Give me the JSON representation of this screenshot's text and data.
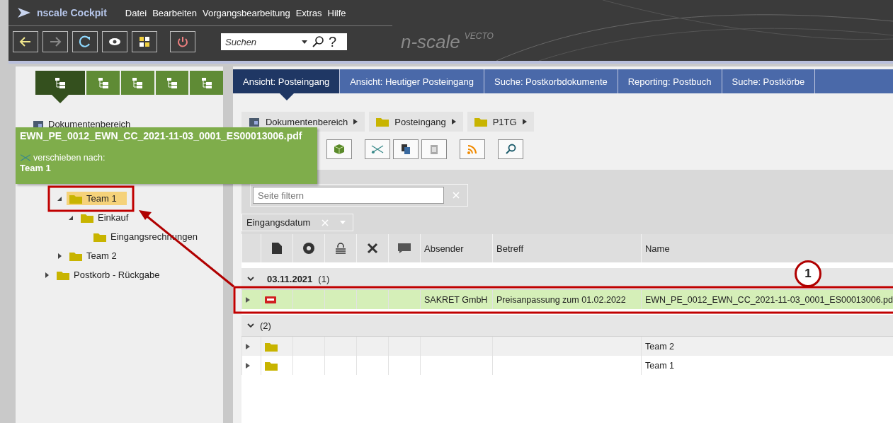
{
  "app": {
    "title": "nscale Cockpit",
    "menu": [
      "Datei",
      "Bearbeiten",
      "Vorgangsbearbeitung",
      "Extras",
      "Hilfe"
    ],
    "search": {
      "placeholder": "Suchen",
      "help": "?"
    },
    "logo": {
      "name": "n-scale",
      "suffix": "VECTO"
    }
  },
  "left_tabs": [
    {
      "selected": true
    },
    {
      "selected": false
    },
    {
      "selected": false
    },
    {
      "selected": false
    },
    {
      "selected": false
    }
  ],
  "tree": {
    "root": "Dokumentenbereich",
    "nested_items": [
      {
        "label": "Team 1",
        "selected": true,
        "expanded": true,
        "children": [
          {
            "label": "Einkauf",
            "selected": false,
            "expanded": true,
            "children": [
              {
                "label": "Eingangsrechnungen",
                "selected": false
              }
            ]
          }
        ]
      },
      {
        "label": "Team 2",
        "selected": false,
        "expanded": false
      }
    ],
    "items": [
      {
        "label": "Postkorb - Rückgabe",
        "selected": false,
        "expanded": false
      }
    ]
  },
  "drag_tooltip": {
    "file": "EWN_PE_0012_EWN_CC_2021-11-03_0001_ES00013006.pdf",
    "action": "verschieben nach:",
    "target": "Team 1"
  },
  "tabs": [
    {
      "label": "Ansicht: Posteingang",
      "selected": true
    },
    {
      "label": "Ansicht: Heutiger Posteingang",
      "selected": false
    },
    {
      "label": "Suche: Postkorbdokumente",
      "selected": false
    },
    {
      "label": "Reporting: Postbuch",
      "selected": false
    },
    {
      "label": "Suche: Postkörbe",
      "selected": false
    }
  ],
  "breadcrumb": [
    {
      "label": "Dokumentenbereich",
      "kind": "area"
    },
    {
      "label": "Posteingang",
      "kind": "folder"
    },
    {
      "label": "P1TG",
      "kind": "folder"
    }
  ],
  "filter": {
    "placeholder": "Seite filtern"
  },
  "grouping": {
    "label": "Eingangsdatum"
  },
  "table": {
    "columns": [
      "Absender",
      "Betreff",
      "Name"
    ],
    "groups": [
      {
        "label": "03.11.2021",
        "count": "(1)",
        "rows": [
          {
            "kind": "document",
            "highlighted": true,
            "cells": [
              "SAKRET GmbH",
              "Preisanpassung zum 01.02.2022",
              "EWN_PE_0012_EWN_CC_2021-11-03_0001_ES00013006.pd"
            ]
          }
        ]
      },
      {
        "count": "(2)",
        "rows": [
          {
            "kind": "folder",
            "highlighted": false,
            "cells": [
              null,
              null,
              "Team 2"
            ]
          },
          {
            "kind": "folder",
            "highlighted": false,
            "cells": [
              null,
              null,
              "Team 1"
            ]
          }
        ]
      }
    ]
  },
  "callout": {
    "number": "1"
  }
}
